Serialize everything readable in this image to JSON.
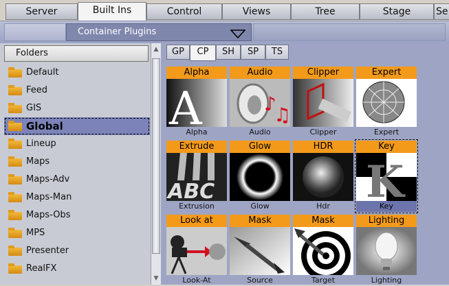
{
  "top_tabs": [
    "Server",
    "Built Ins",
    "Control",
    "Views",
    "Tree",
    "Stage",
    "Se"
  ],
  "active_top_tab": "Built Ins",
  "dropdown": {
    "selected": "Container Plugins",
    "icon": "chevron-down-icon"
  },
  "folders": {
    "header": "Folders",
    "items": [
      "Default",
      "Feed",
      "GIS",
      "Global",
      "Lineup",
      "Maps",
      "Maps-Adv",
      "Maps-Man",
      "Maps-Obs",
      "MPS",
      "Presenter",
      "RealFX"
    ],
    "selected": "Global"
  },
  "sub_tabs": [
    "GP",
    "CP",
    "SH",
    "SP",
    "TS"
  ],
  "active_sub_tab": "CP",
  "plugins": [
    {
      "title": "Alpha",
      "label": "Alpha",
      "icon": "alpha-icon"
    },
    {
      "title": "Audio",
      "label": "Audio",
      "icon": "audio-ear-icon"
    },
    {
      "title": "Clipper",
      "label": "Clipper",
      "icon": "clipper-icon"
    },
    {
      "title": "Expert",
      "label": "Expert",
      "icon": "expert-sphere-icon"
    },
    {
      "title": "Extrude",
      "label": "Extrusion",
      "icon": "extrude-abc-icon"
    },
    {
      "title": "Glow",
      "label": "Glow",
      "icon": "glow-ring-icon"
    },
    {
      "title": "HDR",
      "label": "Hdr",
      "icon": "hdr-sphere-icon"
    },
    {
      "title": "Key",
      "label": "Key",
      "icon": "key-k-icon",
      "selected": true
    },
    {
      "title": "Look at",
      "label": "Look-At",
      "icon": "look-at-camera-icon"
    },
    {
      "title": "Mask",
      "label": "Source",
      "icon": "mask-dart-icon"
    },
    {
      "title": "Mask",
      "label": "Target",
      "icon": "target-dart-icon"
    },
    {
      "title": "Lighting",
      "label": "Lighting",
      "icon": "lightbulb-icon"
    }
  ],
  "colors": {
    "plugin_title_bg": "#f39a1a",
    "selection": "#7b83b8",
    "panel_bg": "#9ea5c4"
  }
}
